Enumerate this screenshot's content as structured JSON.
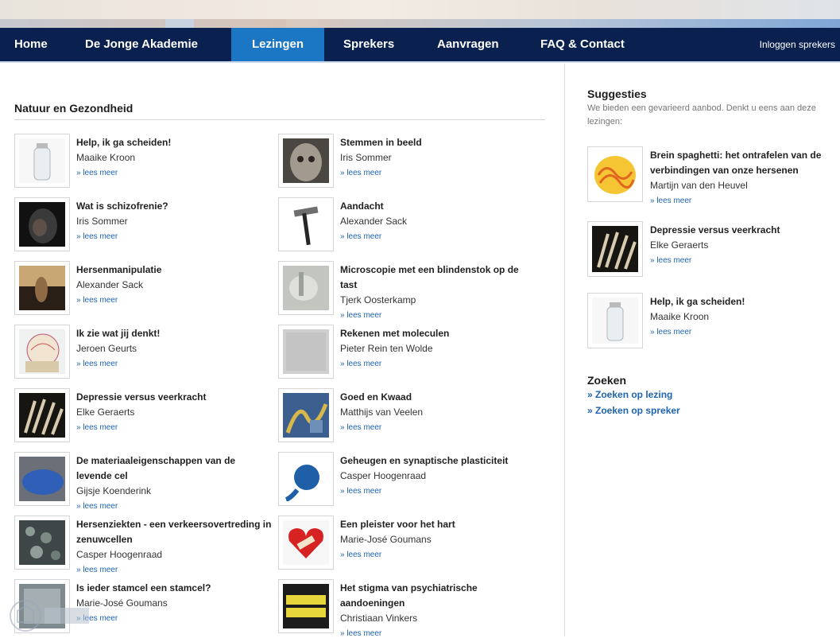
{
  "nav": {
    "items": [
      "Home",
      "De Jonge Akademie",
      "Lezingen",
      "Sprekers",
      "Aanvragen",
      "FAQ & Contact"
    ],
    "active": "Lezingen",
    "login": "Inloggen sprekers"
  },
  "main": {
    "title": "Natuur en Gezondheid",
    "read_more": "» lees meer",
    "left": [
      {
        "title": "Help, ik ga scheiden!",
        "speaker": "Maaike Kroon"
      },
      {
        "title": "Wat is schizofrenie?",
        "speaker": "Iris Sommer"
      },
      {
        "title": "Hersenmanipulatie",
        "speaker": "Alexander Sack"
      },
      {
        "title": "Ik zie wat jij denkt!",
        "speaker": "Jeroen Geurts"
      },
      {
        "title": "Depressie versus veerkracht",
        "speaker": "Elke Geraerts"
      },
      {
        "title": "De materiaaleigenschappen van de levende cel",
        "speaker": "Gijsje Koenderink"
      },
      {
        "title": "Hersenziekten - een verkeersovertreding in zenuwcellen",
        "speaker": "Casper Hoogenraad"
      },
      {
        "title": "Is ieder stamcel een stamcel?",
        "speaker": "Marie-José Goumans"
      }
    ],
    "right": [
      {
        "title": "Stemmen in beeld",
        "speaker": "Iris Sommer"
      },
      {
        "title": "Aandacht",
        "speaker": "Alexander Sack"
      },
      {
        "title": "Microscopie met een blindenstok op de tast",
        "speaker": "Tjerk Oosterkamp"
      },
      {
        "title": "Rekenen met moleculen",
        "speaker": "Pieter Rein ten Wolde"
      },
      {
        "title": "Goed en Kwaad",
        "speaker": "Matthijs van Veelen"
      },
      {
        "title": "Geheugen en synaptische plasticiteit",
        "speaker": "Casper Hoogenraad"
      },
      {
        "title": "Een pleister voor het hart",
        "speaker": "Marie-José Goumans"
      },
      {
        "title": "Het stigma van psychiatrische aandoeningen",
        "speaker": "Christiaan Vinkers"
      }
    ]
  },
  "sidebar": {
    "title": "Suggesties",
    "intro": "We bieden een gevarieerd aanbod. Denkt u eens aan deze lezingen:",
    "items": [
      {
        "title": "Brein spaghetti: het ontrafelen van de verbindingen van onze hersenen",
        "speaker": "Martijn van den Heuvel"
      },
      {
        "title": "Depressie versus veerkracht",
        "speaker": "Elke Geraerts"
      },
      {
        "title": "Help, ik ga scheiden!",
        "speaker": "Maaike Kroon"
      }
    ],
    "search_title": "Zoeken",
    "search_links": [
      "» Zoeken op lezing",
      "» Zoeken op spreker"
    ]
  }
}
